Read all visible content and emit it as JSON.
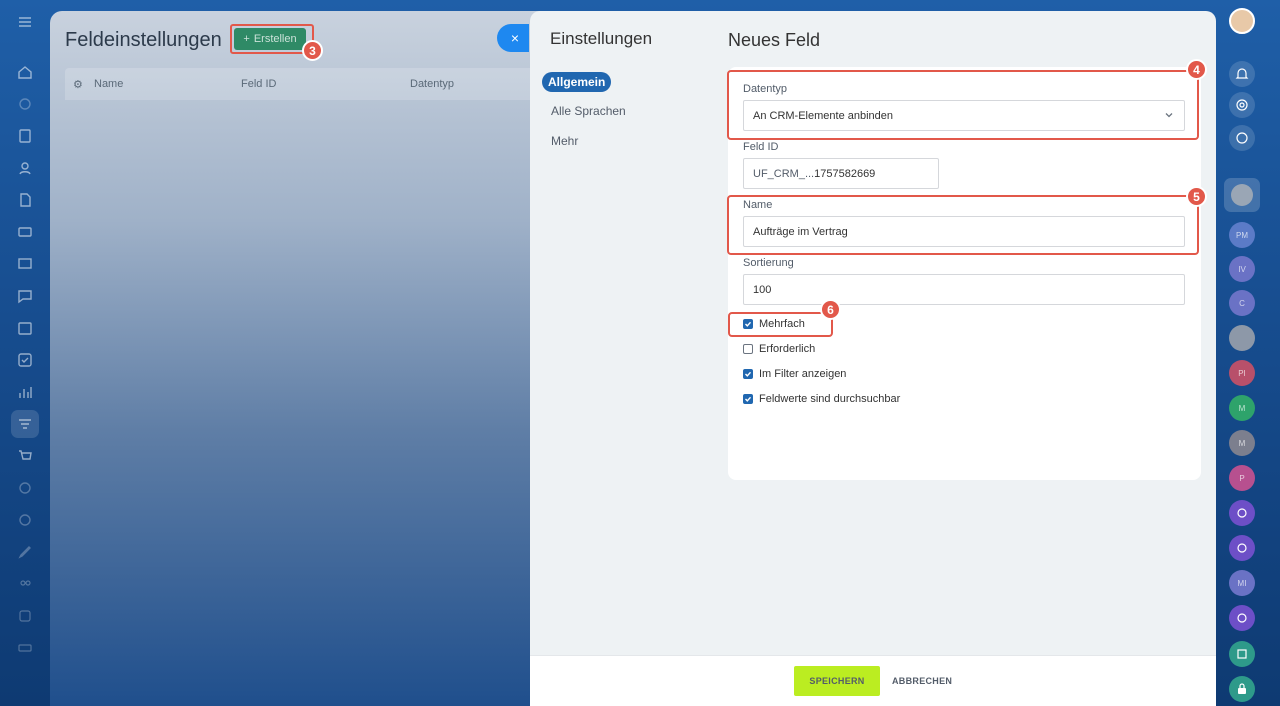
{
  "background_panel": {
    "title": "Feldeinstellungen",
    "create_button": "Erstellen",
    "columns": [
      "Name",
      "Feld ID",
      "Datentyp"
    ],
    "badge": "3"
  },
  "close_label": "×",
  "slider": {
    "title": "Einstellungen",
    "nav": [
      "Allgemein",
      "Alle Sprachen",
      "Mehr"
    ],
    "form_title": "Neues Feld",
    "datatype_label": "Datentyp",
    "datatype_value": "An CRM-Elemente anbinden",
    "field_id_label": "Feld ID",
    "field_id_prefix": "UF_CRM_...",
    "field_id_value": "1757582669",
    "name_label": "Name",
    "name_value": "Aufträge im Vertrag",
    "sort_label": "Sortierung",
    "sort_value": "100",
    "checkboxes": [
      {
        "label": "Mehrfach",
        "checked": true
      },
      {
        "label": "Erforderlich",
        "checked": false
      },
      {
        "label": "Im Filter anzeigen",
        "checked": true
      },
      {
        "label": "Feldwerte sind durchsuchbar",
        "checked": true
      }
    ],
    "badges": [
      "4",
      "5",
      "6"
    ],
    "save": "SPEICHERN",
    "cancel": "ABBRECHEN"
  },
  "right_rail": {
    "avatars": [
      "PM",
      "IV",
      "C",
      "PI",
      "M",
      "M",
      "P",
      "MI"
    ],
    "colors": {
      "accent": "#2067b0",
      "save": "#bbed21",
      "highlight": "#e2584a",
      "create": "#2f8a66"
    }
  }
}
